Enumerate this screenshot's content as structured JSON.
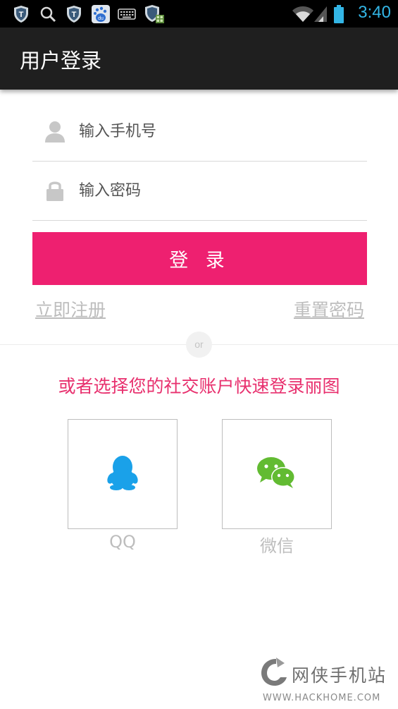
{
  "status_bar": {
    "time": "3:40",
    "icons": [
      "shield-icon",
      "search-icon",
      "shield-icon",
      "baidu-icon",
      "keyboard-icon",
      "shield-grid-icon",
      "wifi-icon",
      "signal-icon",
      "battery-icon"
    ]
  },
  "action_bar": {
    "title": "用户登录"
  },
  "form": {
    "phone": {
      "placeholder": "输入手机号",
      "icon": "person-icon"
    },
    "password": {
      "placeholder": "输入密码",
      "icon": "lock-icon"
    },
    "login_label": "登 录",
    "register_label": "立即注册",
    "reset_label": "重置密码"
  },
  "divider": {
    "label": "or"
  },
  "social": {
    "prompt": "或者选择您的社交账户快速登录丽图",
    "options": [
      {
        "label": "QQ",
        "icon": "qq-penguin-icon",
        "color": "#1aa1e9"
      },
      {
        "label": "微信",
        "icon": "wechat-icon",
        "color": "#62bb32"
      }
    ]
  },
  "watermark": {
    "text": "网侠手机站",
    "url": "WWW.HACKHOME.COM"
  },
  "colors": {
    "accent": "#ee2070",
    "prompt": "#e8306e",
    "status_time": "#33b5e5",
    "action_bar": "#1f1f1f"
  }
}
